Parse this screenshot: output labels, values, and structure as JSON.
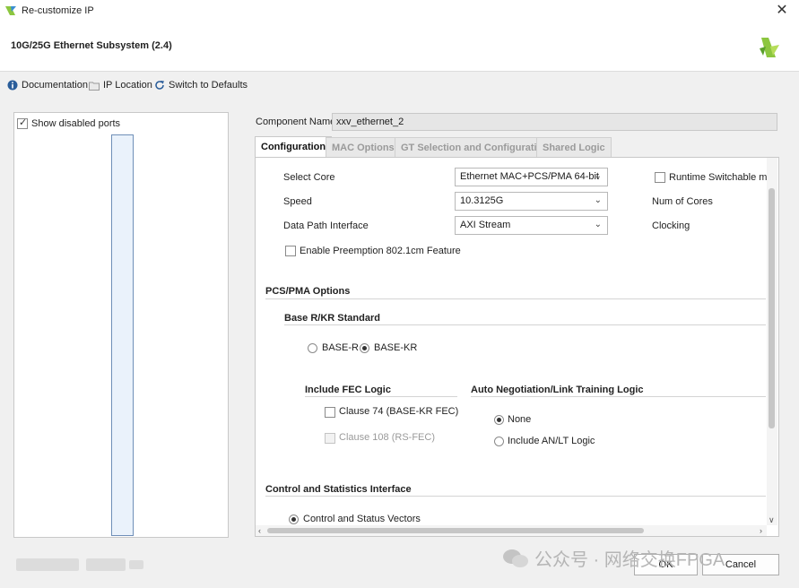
{
  "window": {
    "title": "Re-customize IP",
    "close_glyph": "✕"
  },
  "header": {
    "subsystem_title": "10G/25G Ethernet Subsystem (2.4)"
  },
  "toolbar": {
    "documentation": "Documentation",
    "ip_location": "IP Location",
    "switch_defaults": "Switch to Defaults"
  },
  "left_pane": {
    "show_disabled_ports": "Show disabled ports",
    "show_disabled_ports_checked": true
  },
  "component": {
    "label": "Component Name",
    "value": "xxv_ethernet_2"
  },
  "tabs": [
    {
      "label": "Configuration",
      "active": true
    },
    {
      "label": "MAC Options",
      "active": false
    },
    {
      "label": "GT Selection and Configuration",
      "active": false
    },
    {
      "label": "Shared Logic",
      "active": false
    }
  ],
  "config": {
    "select_core_label": "Select Core",
    "select_core_value": "Ethernet MAC+PCS/PMA 64-bit",
    "speed_label": "Speed",
    "speed_value": "10.3125G",
    "data_path_label": "Data Path Interface",
    "data_path_value": "AXI Stream",
    "runtime_switchable": "Runtime Switchable mod",
    "num_cores": "Num of Cores",
    "clocking": "Clocking",
    "enable_preemption": "Enable Preemption 802.1cm Feature"
  },
  "pcs_pma": {
    "section": "PCS/PMA Options",
    "base_standard": "Base R/KR Standard",
    "base_r": "BASE-R",
    "base_kr": "BASE-KR",
    "selected_standard": "BASE-KR",
    "fec_heading": "Include FEC Logic",
    "clause74": "Clause 74 (BASE-KR FEC)",
    "clause108": "Clause 108 (RS-FEC)",
    "autoneg_heading": "Auto Negotiation/Link Training Logic",
    "none": "None",
    "include_anlt": "Include AN/LT Logic",
    "selected_autoneg": "None"
  },
  "control_stats": {
    "section": "Control and Statistics Interface",
    "control_status_vectors": "Control and Status Vectors"
  },
  "footer": {
    "ok": "OK",
    "cancel": "Cancel",
    "watermark": "公众号 · 网络交换FPGA"
  },
  "colors": {
    "accent": "#2a5d9a",
    "logo_green": "#9acd32"
  }
}
